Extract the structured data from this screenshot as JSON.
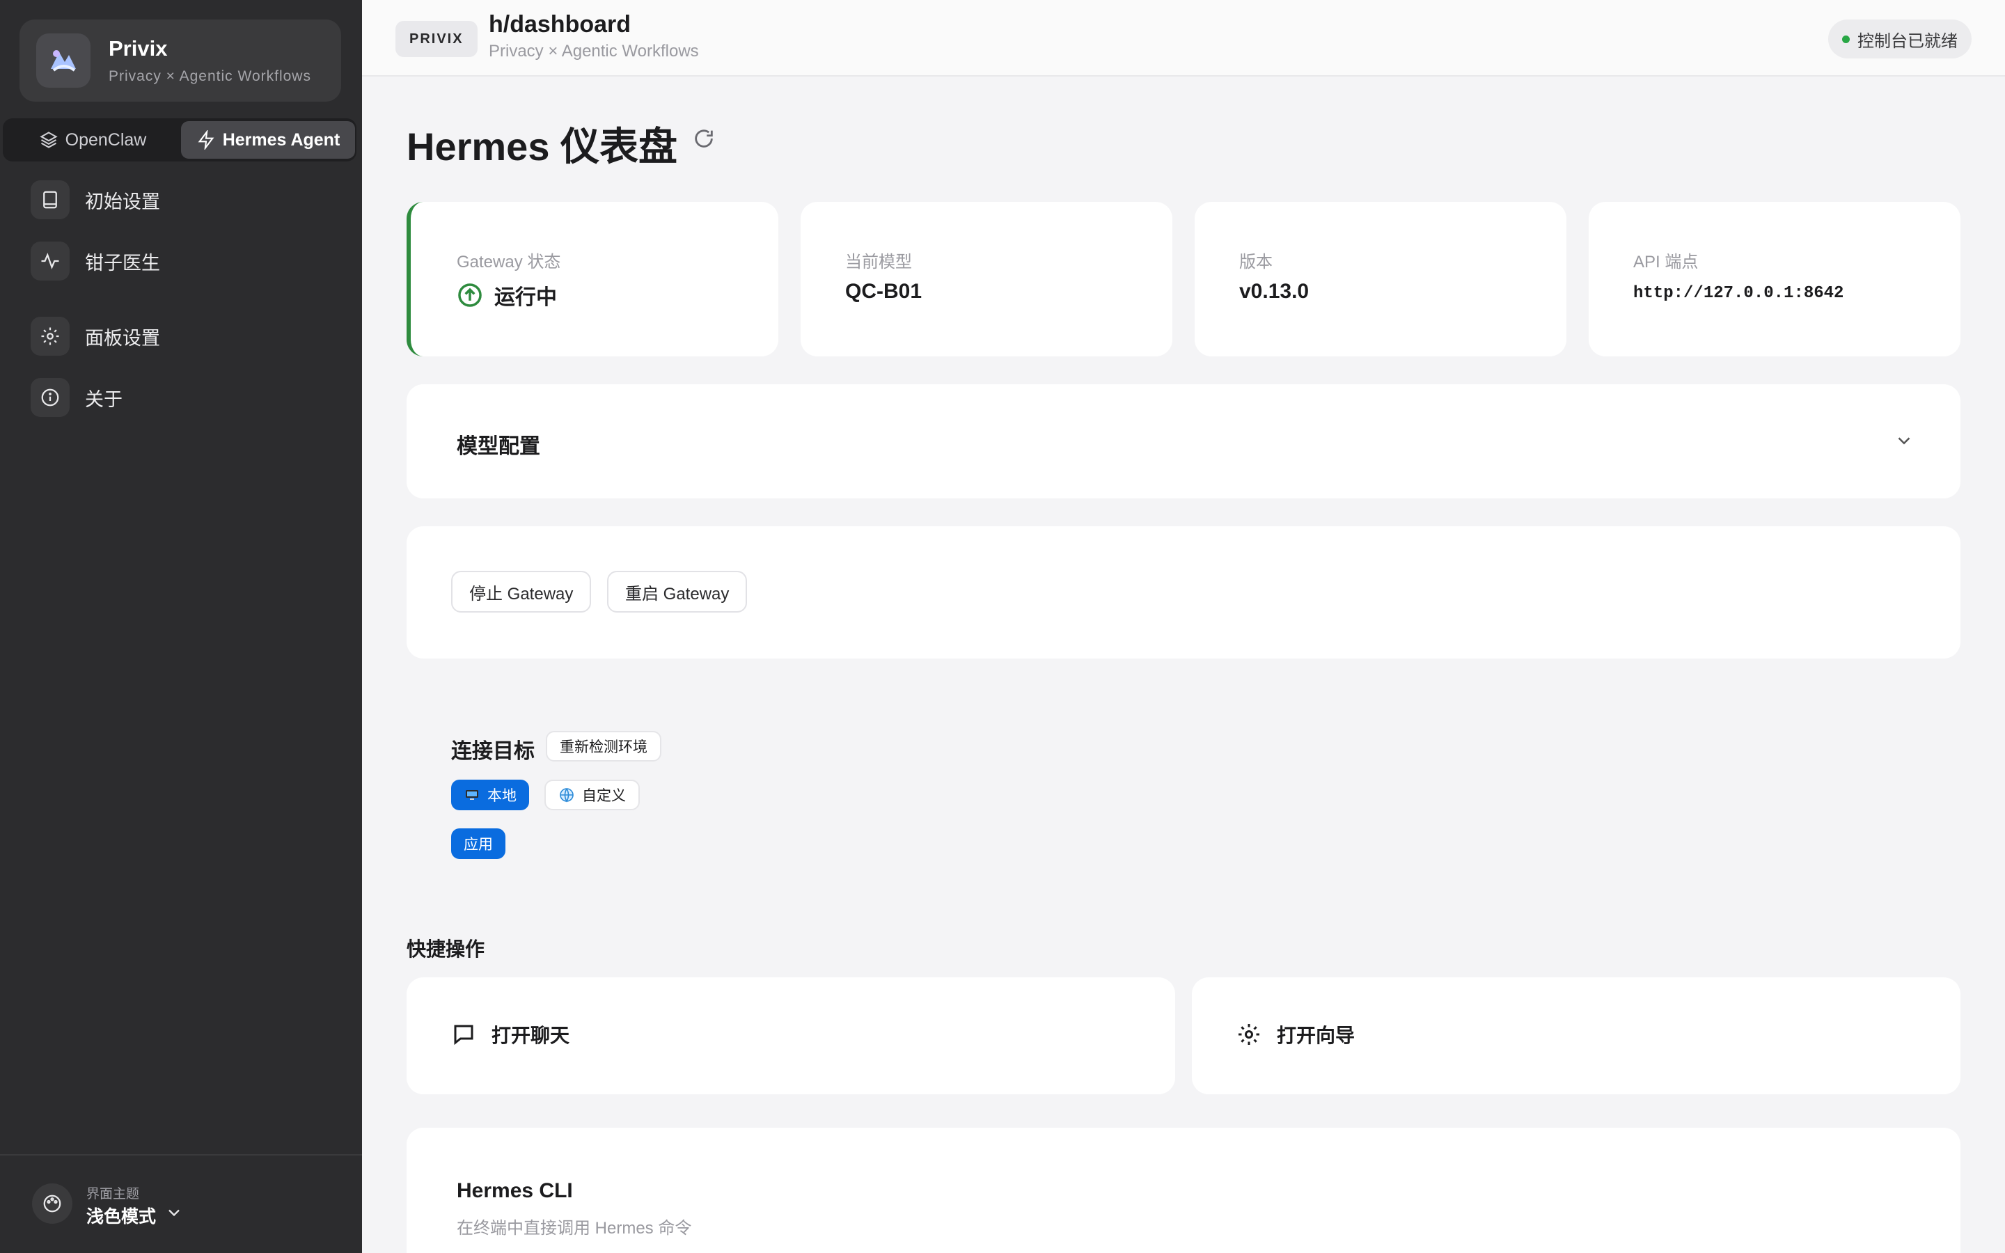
{
  "brand": {
    "name": "Privix",
    "subtitle": "Privacy × Agentic Workflows"
  },
  "modes": [
    {
      "label": "OpenClaw",
      "icon": "layers-icon",
      "active": false
    },
    {
      "label": "Hermes Agent",
      "icon": "bolt-icon",
      "active": true
    }
  ],
  "sidebar": {
    "items": [
      {
        "label": "初始设置",
        "icon": "book-icon"
      },
      {
        "label": "钳子医生",
        "icon": "pulse-icon"
      },
      {
        "label": "面板设置",
        "icon": "gear-icon"
      },
      {
        "label": "关于",
        "icon": "info-icon"
      }
    ],
    "theme": {
      "label": "界面主题",
      "value": "浅色模式"
    }
  },
  "topbar": {
    "tag": "PRIVIX",
    "path": "h/dashboard",
    "subtitle": "Privacy × Agentic Workflows",
    "status": "控制台已就绪"
  },
  "page": {
    "title": "Hermes 仪表盘"
  },
  "stats": [
    {
      "label": "Gateway 状态",
      "value": "运行中"
    },
    {
      "label": "当前模型",
      "value": "QC-B01"
    },
    {
      "label": "版本",
      "value": "v0.13.0"
    },
    {
      "label": "API 端点",
      "value": "http://127.0.0.1:8642"
    }
  ],
  "model_config": {
    "title": "模型配置"
  },
  "gateway_actions": {
    "stop": "停止 Gateway",
    "restart": "重启 Gateway"
  },
  "connection": {
    "title": "连接目标",
    "redetect": "重新检测环境",
    "options": [
      {
        "label": "本地",
        "icon": "monitor-icon",
        "selected": true
      },
      {
        "label": "自定义",
        "icon": "globe-icon",
        "selected": false
      }
    ],
    "apply": "应用"
  },
  "quick_actions": {
    "title": "快捷操作",
    "items": [
      {
        "label": "打开聊天",
        "icon": "chat-icon"
      },
      {
        "label": "打开向导",
        "icon": "gear-icon"
      }
    ]
  },
  "cli": {
    "title": "Hermes CLI",
    "subtitle": "在终端中直接调用 Hermes 命令"
  },
  "colors": {
    "accent": "#0a6cdf",
    "running": "#2e8b3e",
    "sidebar": "#2c2c2e"
  }
}
